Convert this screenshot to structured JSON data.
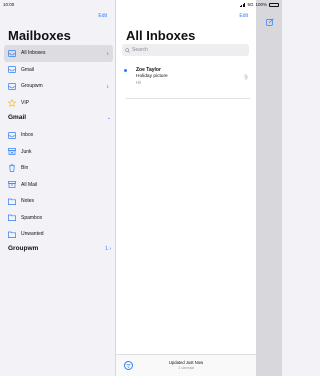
{
  "status": {
    "time": "10:00",
    "network": "5G",
    "battery": "100%"
  },
  "sidebar": {
    "edit_label": "Edit",
    "title": "Mailboxes",
    "mailboxes": [
      {
        "label": "All Inboxes",
        "count": "1",
        "icon": "inbox-icon"
      },
      {
        "label": "Gmail",
        "count": "",
        "icon": "inbox-icon"
      },
      {
        "label": "Groupwm",
        "count": "1",
        "icon": "inbox-icon"
      },
      {
        "label": "VIP",
        "count": "",
        "icon": "star-icon"
      }
    ],
    "gmail_section": {
      "title": "Gmail",
      "folders": [
        {
          "label": "Inbox",
          "icon": "inbox-icon"
        },
        {
          "label": "Junk",
          "icon": "junk-icon"
        },
        {
          "label": "Bin",
          "icon": "trash-icon"
        },
        {
          "label": "All Mail",
          "icon": "archive-icon"
        },
        {
          "label": "Notes",
          "icon": "folder-icon"
        },
        {
          "label": "Spambox",
          "icon": "folder-icon"
        },
        {
          "label": "Unwanted",
          "icon": "folder-icon"
        }
      ]
    },
    "groupwm_section": {
      "title": "Groupwm",
      "count": "1"
    }
  },
  "message_list": {
    "edit_label": "Edit",
    "title": "All Inboxes",
    "search_placeholder": "Search",
    "messages": [
      {
        "sender": "Zoe Taylor",
        "subject": "Holiday picture",
        "preview": "Hi!",
        "unread": true,
        "has_attachment": true
      }
    ],
    "updated_text": "Updated Just Now",
    "unread_text": "1 Unread"
  },
  "colors": {
    "accent": "#2f7ff7",
    "background": "#f2f2f7",
    "selected": "#dcdce1",
    "detail_pane": "#d8d8dc"
  }
}
